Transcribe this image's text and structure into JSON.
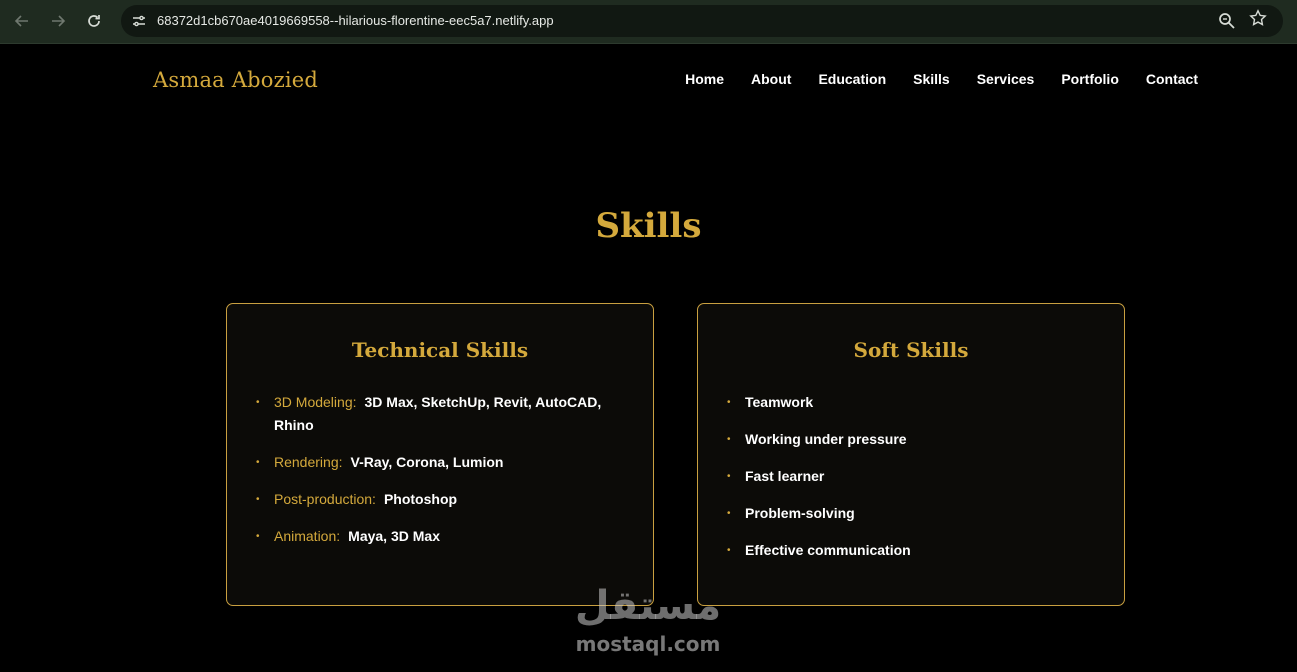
{
  "browser": {
    "url": "68372d1cb670ae4019669558--hilarious-florentine-eec5a7.netlify.app",
    "icons": {
      "back": "arrow-left-icon",
      "forward": "arrow-right-icon",
      "reload": "reload-icon",
      "site_info": "tune-icon",
      "zoom": "zoom-icon",
      "bookmark": "star-icon"
    }
  },
  "header": {
    "brand": "Asmaa Abozied",
    "nav": [
      "Home",
      "About",
      "Education",
      "Skills",
      "Services",
      "Portfolio",
      "Contact"
    ]
  },
  "section": {
    "title": "Skills"
  },
  "technical": {
    "title": "Technical Skills",
    "items": [
      {
        "label": "3D Modeling:",
        "value": "3D Max, SketchUp, Revit, AutoCAD, Rhino"
      },
      {
        "label": "Rendering:",
        "value": "V-Ray, Corona, Lumion"
      },
      {
        "label": "Post-production:",
        "value": "Photoshop"
      },
      {
        "label": "Animation:",
        "value": "Maya, 3D Max"
      }
    ]
  },
  "soft": {
    "title": "Soft Skills",
    "items": [
      "Teamwork",
      "Working under pressure",
      "Fast learner",
      "Problem-solving",
      "Effective communication"
    ]
  },
  "watermark": {
    "arabic": "مستقل",
    "latin": "mostaql.com"
  },
  "colors": {
    "accent": "#d4a93c",
    "background": "#000000",
    "card_bg": "#0c0b08",
    "browser_bar": "#1f2b20"
  }
}
